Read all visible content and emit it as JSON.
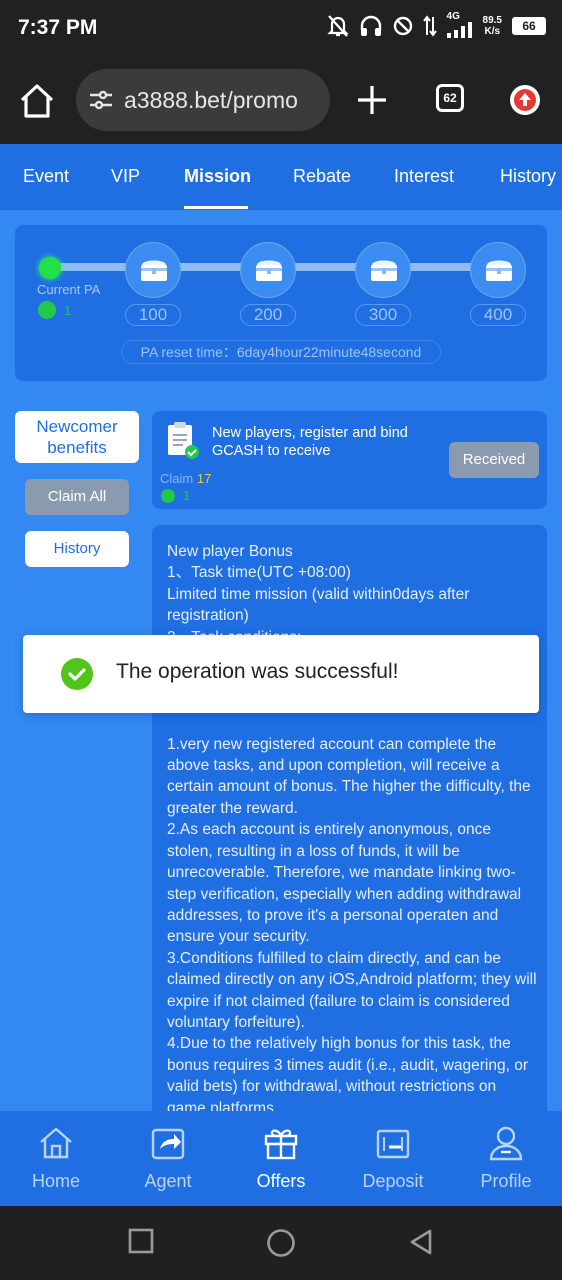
{
  "status_bar": {
    "time": "7:37 PM",
    "network": "4G",
    "speed": "89.5",
    "speed_unit": "K/s",
    "battery": "66"
  },
  "browser": {
    "url": "a3888.bet/promo",
    "tab_count": "62"
  },
  "tabs": [
    "Event",
    "VIP",
    "Mission",
    "Rebate",
    "Interest",
    "History"
  ],
  "active_tab": "Mission",
  "pa": {
    "current_label": "Current PA",
    "current_value": "1",
    "milestones": [
      "100",
      "200",
      "300",
      "400"
    ],
    "reset_text": "PA reset time：6day4hour22minute48second"
  },
  "side": {
    "newcomer": "Newcomer benefits",
    "claim_all": "Claim All",
    "history": "History"
  },
  "task": {
    "title": "New players, register and bind GCASH to receive",
    "button": "Received",
    "claim_label": "Claim",
    "claim_value": "17",
    "reward": "1"
  },
  "description": "New player Bonus\n1、Task time(UTC +08:00)\nLimited time mission (valid within0days after registration)\n2、Task conditions:\n\n\n\n\n1.very new registered account can complete the above tasks, and upon completion, will receive a certain amount of bonus. The higher the difficulty, the greater the reward.\n2.As each account is entirely anonymous, once stolen, resulting in a loss of funds, it will be unrecoverable. Therefore, we mandate linking two-step verification, especially when adding withdrawal addresses, to prove it's a personal operaten and ensure your security.\n3.Conditions fulfilled to claim directly, and can be claimed directly on any iOS,Android platform; they will expire if not claimed (failure to claim is considered voluntary forfeiture).\n4.Due to the relatively high bonus for this task, the bonus requires 3 times audit (i.e., audit, wagering, or valid bets) for withdrawal, without restrictions on game platforms.",
  "toast": "The operation was successful!",
  "bottom_nav": [
    "Home",
    "Agent",
    "Offers",
    "Deposit",
    "Profile"
  ],
  "active_nav": "Offers"
}
